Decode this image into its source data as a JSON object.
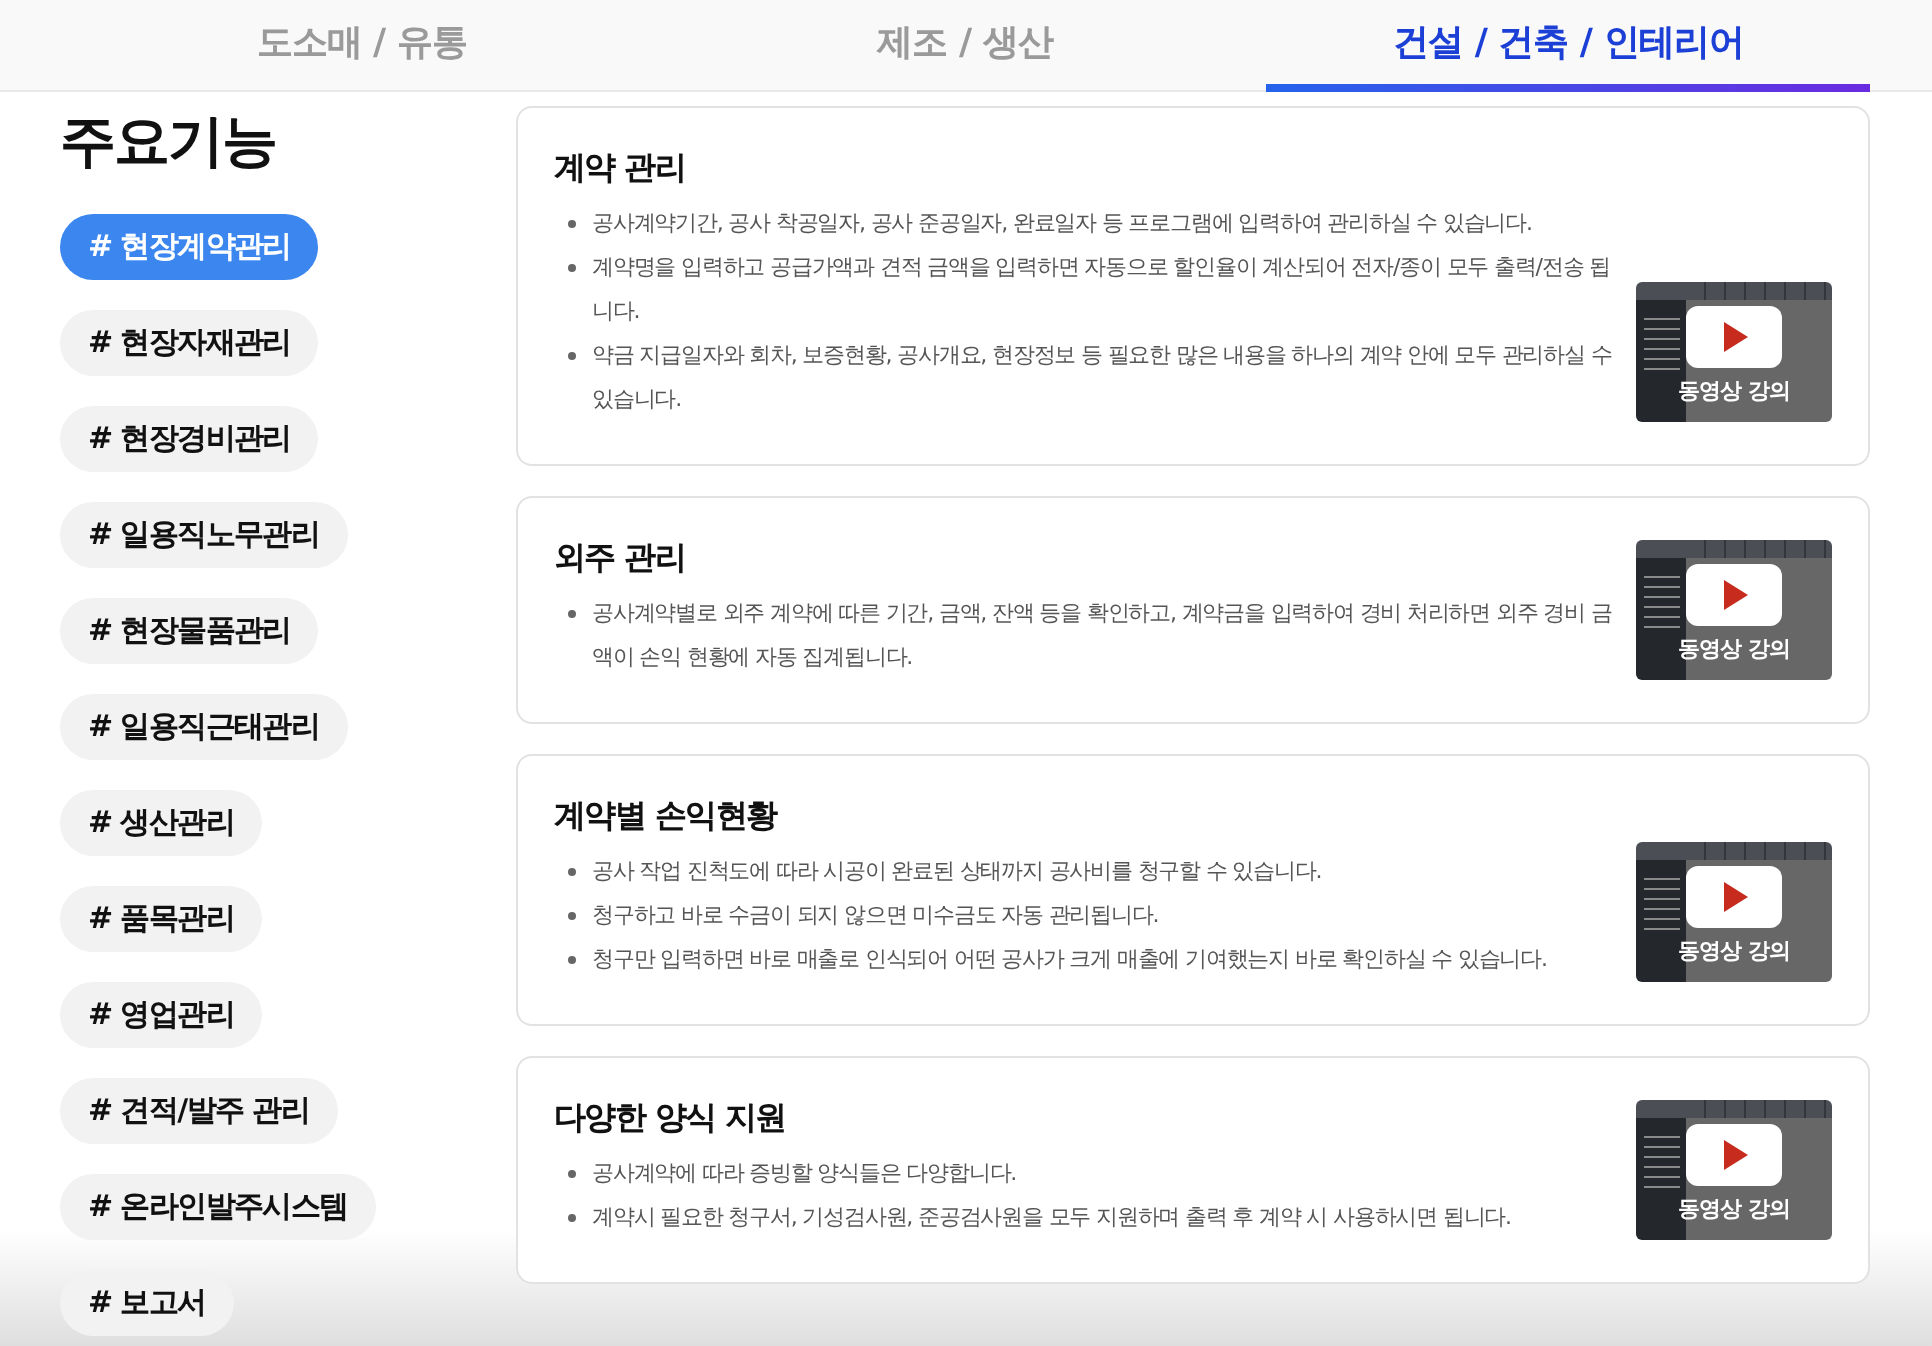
{
  "tabs": [
    {
      "label": "도소매 / 유통",
      "selected": false
    },
    {
      "label": "제조 / 생산",
      "selected": false
    },
    {
      "label": "건설 / 건축 / 인테리어",
      "selected": true
    }
  ],
  "sidebar": {
    "title": "주요기능",
    "items": [
      {
        "label": "# 현장계약관리",
        "selected": true
      },
      {
        "label": "# 현장자재관리",
        "selected": false
      },
      {
        "label": "# 현장경비관리",
        "selected": false
      },
      {
        "label": "# 일용직노무관리",
        "selected": false
      },
      {
        "label": "# 현장물품관리",
        "selected": false
      },
      {
        "label": "# 일용직근태관리",
        "selected": false
      },
      {
        "label": "# 생산관리",
        "selected": false
      },
      {
        "label": "# 품목관리",
        "selected": false
      },
      {
        "label": "# 영업관리",
        "selected": false
      },
      {
        "label": "# 견적/발주 관리",
        "selected": false
      },
      {
        "label": "# 온라인발주시스템",
        "selected": false
      },
      {
        "label": "# 보고서",
        "selected": false
      }
    ]
  },
  "features": [
    {
      "title": "계약 관리",
      "bullets": [
        "공사계약기간, 공사 착공일자, 공사 준공일자, 완료일자 등 프로그램에 입력하여 관리하실 수 있습니다.",
        "계약명을 입력하고 공급가액과 견적 금액을 입력하면 자동으로 할인율이 계산되어 전자/종이 모두 출력/전송 됩니다.",
        "약금 지급일자와 회차, 보증현황, 공사개요, 현장정보 등 필요한 많은 내용을 하나의 계약 안에 모두 관리하실 수 있습니다."
      ],
      "video_label": "동영상 강의"
    },
    {
      "title": "외주 관리",
      "bullets": [
        "공사계약별로 외주 계약에 따른 기간, 금액, 잔액 등을 확인하고, 계약금을 입력하여 경비 처리하면 외주 경비 금액이 손익 현황에 자동 집계됩니다."
      ],
      "video_label": "동영상 강의"
    },
    {
      "title": "계약별 손익현황",
      "bullets": [
        "공사 작업 진척도에 따라 시공이 완료된 상태까지 공사비를 청구할 수 있습니다.",
        "청구하고 바로 수금이 되지 않으면 미수금도 자동 관리됩니다.",
        "청구만 입력하면 바로 매출로 인식되어 어떤 공사가 크게 매출에 기여했는지 바로 확인하실 수 있습니다."
      ],
      "video_label": "동영상 강의"
    },
    {
      "title": "다양한 양식 지원",
      "bullets": [
        "공사계약에 따라 증빙할 양식들은 다양합니다.",
        "계약시 필요한 청구서, 기성검사원, 준공검사원을 모두 지원하며 출력 후 계약 시 사용하시면 됩니다."
      ],
      "video_label": "동영상 강의"
    }
  ]
}
